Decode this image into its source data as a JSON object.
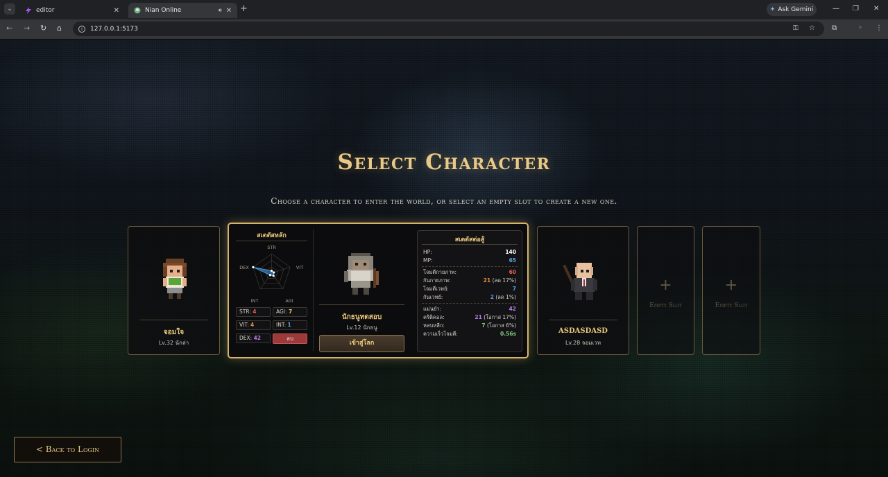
{
  "browser": {
    "tabs": [
      {
        "title": "editor",
        "active": false
      },
      {
        "title": "Nian Online",
        "active": true
      }
    ],
    "url": "127.0.0.1:5173",
    "ask_gemini": "Ask Gemini"
  },
  "page": {
    "title": "Select Character",
    "subtitle": "Choose a character to enter the world, or select an empty slot to create a new one."
  },
  "characters": [
    {
      "name": "จอมใจ",
      "sub": "Lv.32 นักล่า"
    },
    {
      "name": "นักธนูทดสอบ",
      "sub": "Lv.12 นักธนู",
      "selected": true,
      "stats_title": "สเตตัสหลัก",
      "radar_axes": [
        "STR",
        "VIT",
        "AGI",
        "INT",
        "DEX"
      ],
      "radar_values": [
        4,
        4,
        7,
        1,
        42
      ],
      "stats": [
        {
          "label": "STR:",
          "value": "4",
          "color": "#e0605a"
        },
        {
          "label": "AGI:",
          "value": "7",
          "color": "#e5c878"
        },
        {
          "label": "VIT:",
          "value": "4",
          "color": "#e09040"
        },
        {
          "label": "INT:",
          "value": "1",
          "color": "#5aa0e0"
        },
        {
          "label": "DEX:",
          "value": "42",
          "color": "#b57ae8"
        }
      ],
      "delete_label": "ลบ",
      "enter_label": "เข้าสู่โลก",
      "combat_title": "สเตตัสต่อสู้",
      "combat_groups": [
        [
          {
            "label": "HP:",
            "value": "140",
            "extra": "",
            "color": "#ffffff"
          },
          {
            "label": "MP:",
            "value": "65",
            "extra": "",
            "color": "#5aa0e0"
          }
        ],
        [
          {
            "label": "โจมตีกายภาพ:",
            "value": "60",
            "extra": "",
            "color": "#e0605a"
          },
          {
            "label": "กันกายภาพ:",
            "value": "21",
            "extra": " (ลด 17%)",
            "color": "#e09040"
          },
          {
            "label": "โจมตีเวทย์:",
            "value": "7",
            "extra": "",
            "color": "#5aa0e0"
          },
          {
            "label": "กันเวทย์:",
            "value": "2",
            "extra": " (ลด 1%)",
            "color": "#5aa0e0"
          }
        ],
        [
          {
            "label": "แม่นยำ:",
            "value": "42",
            "extra": "",
            "color": "#b57ae8"
          },
          {
            "label": "คริติคอล:",
            "value": "21",
            "extra": " (โอกาส 17%)",
            "color": "#b57ae8"
          },
          {
            "label": "หลบหลีก:",
            "value": "7",
            "extra": " (โอกาส 6%)",
            "color": "#7fc97a"
          },
          {
            "label": "ความเร็วโจมตี:",
            "value": "0.56s",
            "extra": "",
            "color": "#7fc97a"
          }
        ]
      ]
    },
    {
      "name": "ASDASDASD",
      "sub": "Lv.28 จอมเวท"
    }
  ],
  "empty_slots": [
    {
      "plus": "+",
      "label": "Empty Slot"
    },
    {
      "plus": "+",
      "label": "Empty Slot"
    }
  ],
  "back_button": "< Back to Login",
  "colors": {
    "accent_gold": "#e9c988",
    "card_border": "#6f5b3c",
    "selected_border": "#d6b46c"
  }
}
